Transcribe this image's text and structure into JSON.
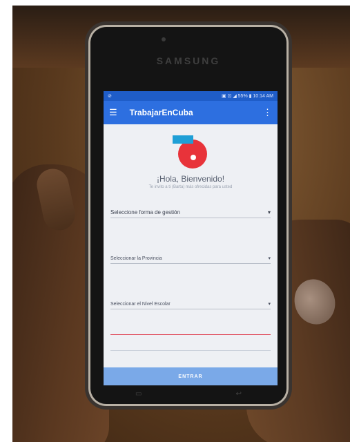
{
  "phone": {
    "brand": "SAMSUNG"
  },
  "status_bar": {
    "left": "⊘",
    "right": "▣ ⊡ ◢ 55% ▮ 10:14 AM"
  },
  "app_bar": {
    "title": "TrabajarEnCuba",
    "menu_icon": "hamburger-icon",
    "more_icon": "overflow-menu-icon"
  },
  "screen": {
    "greeting": "¡Hola, Bienvenido!",
    "subtitle": "Te invito a ti (Barta) más ofrecidas para usted",
    "fields": [
      {
        "label": "Seleccione forma de gestión"
      },
      {
        "label": "Seleccionar la Provincia"
      },
      {
        "label": "Seleccionar el Nivel Escolar"
      }
    ],
    "button_label": "ENTRAR"
  },
  "colors": {
    "app_bar": "#2d6fe0",
    "status_bar": "#1f5dc8",
    "accent_red": "#e8333a",
    "accent_blue": "#1f9fd6",
    "button": "#7aa9e8"
  }
}
